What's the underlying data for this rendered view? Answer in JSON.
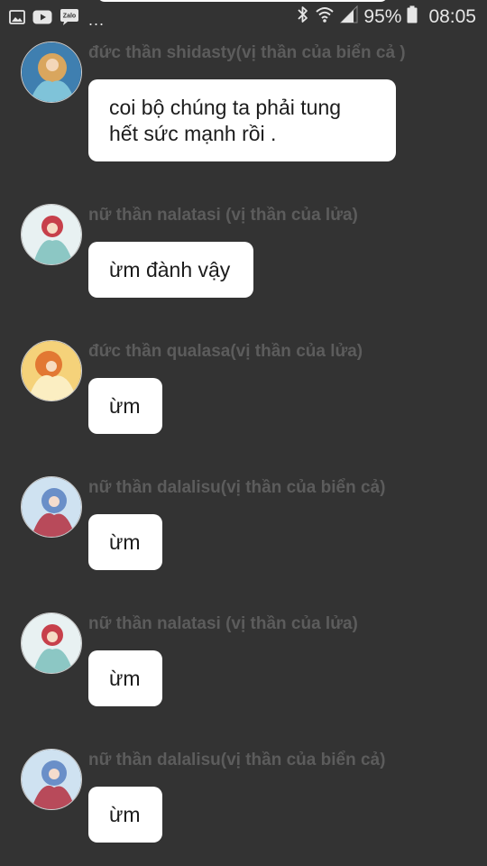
{
  "status_bar": {
    "notification_icons": [
      "image-icon",
      "youtube-icon",
      "zalo-icon"
    ],
    "zalo_label": "Zalo",
    "more_label": "...",
    "system_icons": [
      "bluetooth-icon",
      "wifi-icon",
      "signal-icon",
      "battery-icon"
    ],
    "battery_percent": "95%",
    "time": "08:05"
  },
  "messages": [
    {
      "sender": "đức thần shidasty(vị thần của biển cả )",
      "text": "coi bộ chúng ta phải tung\nhết sức mạnh rồi .",
      "avatar": "avatar-shidasty",
      "avatar_colors": [
        "#3f7fb0",
        "#d9a65e",
        "#7fc3d9"
      ]
    },
    {
      "sender": "nữ thần nalatasi (vị thần của lửa)",
      "text": "ừm đành vậy",
      "avatar": "avatar-nalatasi",
      "avatar_colors": [
        "#e8f1f2",
        "#c7404b",
        "#8cc7c4"
      ]
    },
    {
      "sender": "đức thần qualasa(vị thần của lửa)",
      "text": "ừm",
      "avatar": "avatar-qualasa",
      "avatar_colors": [
        "#f5d27a",
        "#e27833",
        "#fbeec2"
      ]
    },
    {
      "sender": "nữ thần dalalisu(vị thần của biển cả)",
      "text": "ừm",
      "avatar": "avatar-dalalisu",
      "avatar_colors": [
        "#cfe2f1",
        "#6a8fc8",
        "#b84a5a"
      ]
    },
    {
      "sender": "nữ thần nalatasi (vị thần của lửa)",
      "text": "ừm",
      "avatar": "avatar-nalatasi",
      "avatar_colors": [
        "#e8f1f2",
        "#c7404b",
        "#8cc7c4"
      ]
    },
    {
      "sender": "nữ thần dalalisu(vị thần của biển cả)",
      "text": "ừm",
      "avatar": "avatar-dalalisu",
      "avatar_colors": [
        "#cfe2f1",
        "#6a8fc8",
        "#b84a5a"
      ]
    }
  ],
  "colors": {
    "background": "#333333",
    "bubble": "#ffffff",
    "sender_name": "#5c5c5c",
    "message_text": "#1c1c1c",
    "status_text": "#e6e6e6"
  }
}
